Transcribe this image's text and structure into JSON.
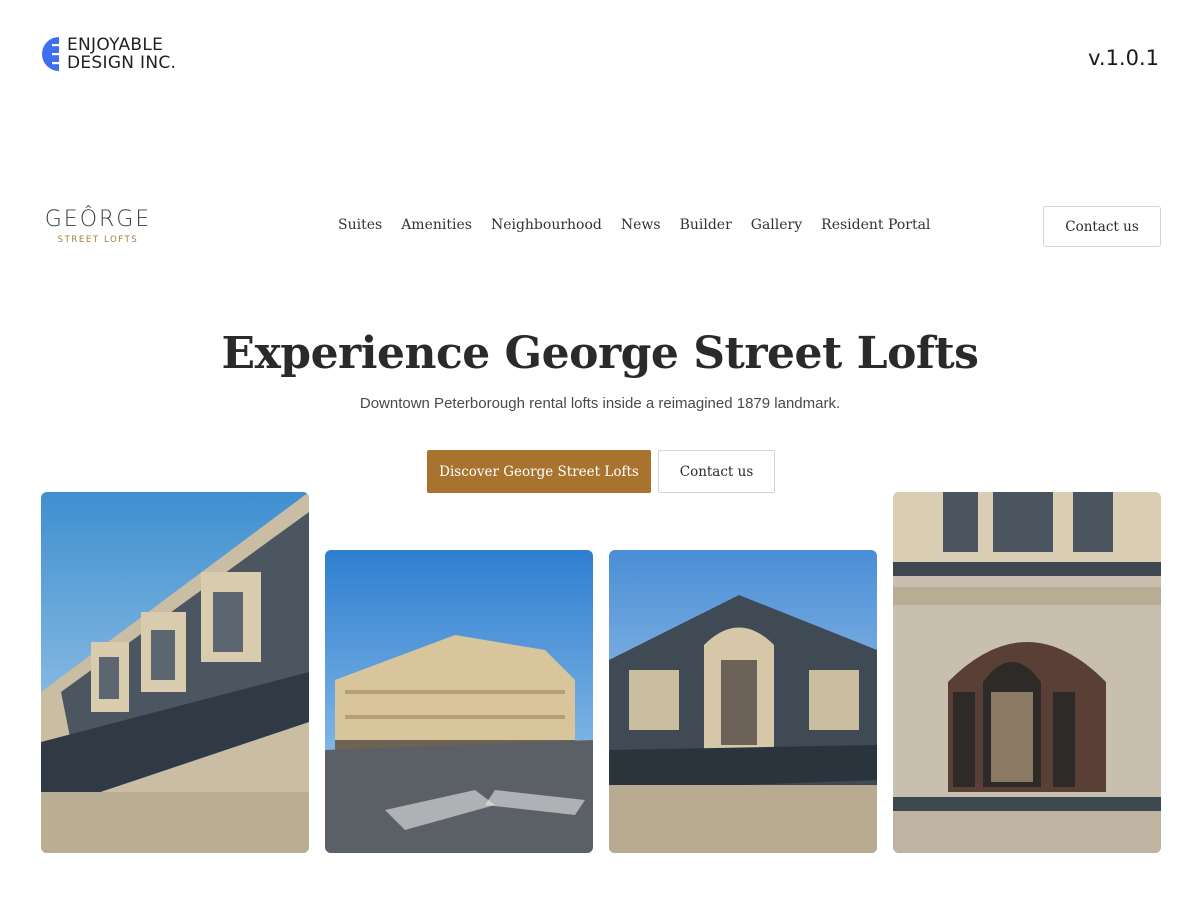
{
  "agency": {
    "name_line1": "ENJOYABLE",
    "name_line2": "DESIGN INC.",
    "version": "v.1.0.1",
    "brand_color": "#3d6ff0"
  },
  "site": {
    "logo_word": "GEÔRGE",
    "logo_sub": "STREET LOFTS",
    "accent_color": "#a8732f",
    "nav": [
      "Suites",
      "Amenities",
      "Neighbourhood",
      "News",
      "Builder",
      "Gallery",
      "Resident Portal"
    ],
    "header_contact_label": "Contact us"
  },
  "hero": {
    "title": "Experience George Street Lofts",
    "subtitle": "Downtown Peterborough rental lofts inside a reimagined 1879 landmark.",
    "primary_label": "Discover George Street Lofts",
    "secondary_label": "Contact us"
  },
  "gallery": {
    "photos": [
      {
        "subject": "rooftop dormers with blue sky"
      },
      {
        "subject": "historic building at street corner"
      },
      {
        "subject": "corner dormer roofline"
      },
      {
        "subject": "arched window on brick facade"
      }
    ]
  }
}
